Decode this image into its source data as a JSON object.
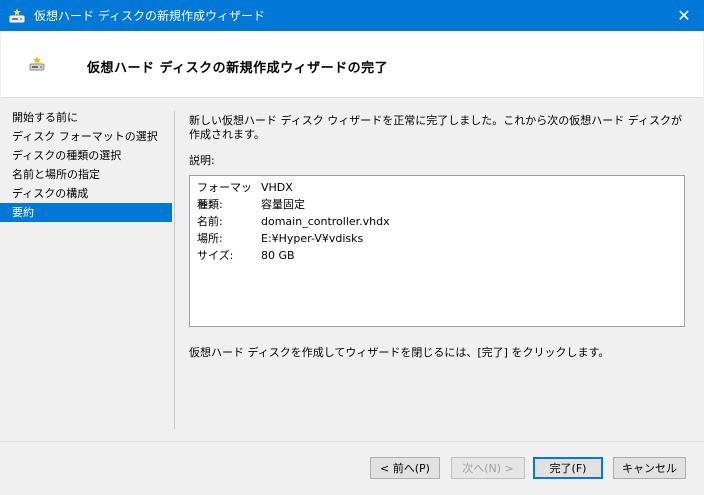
{
  "window": {
    "title": "仮想ハード ディスクの新規作成ウィザード",
    "close_glyph": "✕"
  },
  "header": {
    "title": "仮想ハード ディスクの新規作成ウィザードの完了"
  },
  "nav": {
    "items": [
      {
        "label": "開始する前に",
        "active": false
      },
      {
        "label": "ディスク フォーマットの選択",
        "active": false
      },
      {
        "label": "ディスクの種類の選択",
        "active": false
      },
      {
        "label": "名前と場所の指定",
        "active": false
      },
      {
        "label": "ディスクの構成",
        "active": false
      },
      {
        "label": "要約",
        "active": true
      }
    ]
  },
  "content": {
    "intro": "新しい仮想ハード ディスク ウィザードを正常に完了しました。これから次の仮想ハード ディスクが作成されます。",
    "description_label": "説明:",
    "summary": [
      {
        "key": "フォーマット:",
        "value": "VHDX"
      },
      {
        "key": "種類:",
        "value": "容量固定"
      },
      {
        "key": "名前:",
        "value": "domain_controller.vhdx"
      },
      {
        "key": "場所:",
        "value": "E:¥Hyper-V¥vdisks"
      },
      {
        "key": "サイズ:",
        "value": "80 GB"
      }
    ],
    "footer": "仮想ハード ディスクを作成してウィザードを閉じるには、[完了] をクリックします。"
  },
  "buttons": {
    "back": "< 前へ(P)",
    "next": "次へ(N) >",
    "finish": "完了(F)",
    "cancel": "キャンセル"
  },
  "colors": {
    "accent": "#0078d7"
  }
}
